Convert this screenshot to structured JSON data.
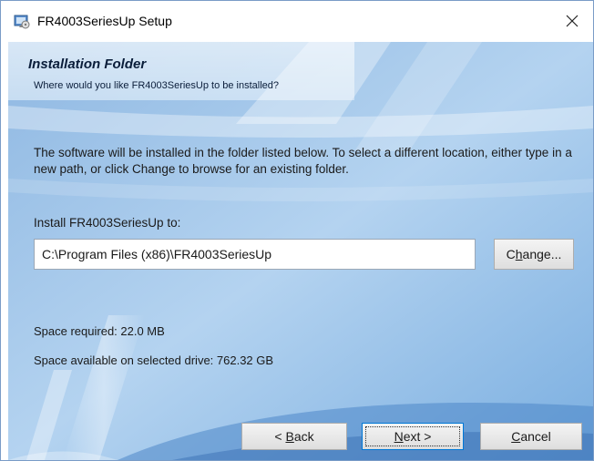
{
  "window": {
    "title": "FR4003SeriesUp Setup",
    "icon": "installer-icon",
    "close_icon": "close-icon"
  },
  "header": {
    "title": "Installation Folder",
    "subtitle": "Where would you like FR4003SeriesUp to be installed?"
  },
  "body": {
    "description": "The software will be installed in the folder listed below. To select a different location, either type in a new path, or click Change to browse for an existing folder.",
    "install_label": "Install FR4003SeriesUp to:",
    "install_path": "C:\\Program Files (x86)\\FR4003SeriesUp",
    "change_button": {
      "pre": "C",
      "mnemonic": "h",
      "post": "ange..."
    },
    "space_required": "Space required: 22.0 MB",
    "space_available": "Space available on selected drive: 762.32 GB"
  },
  "buttons": {
    "back": {
      "pre": "< ",
      "mnemonic": "B",
      "post": "ack"
    },
    "next": {
      "pre": "",
      "mnemonic": "N",
      "post": "ext >"
    },
    "cancel": {
      "pre": "",
      "mnemonic": "C",
      "post": "ancel"
    }
  },
  "colors": {
    "panel_blue": "#9fc3e6",
    "focus_blue": "#0078d7"
  }
}
